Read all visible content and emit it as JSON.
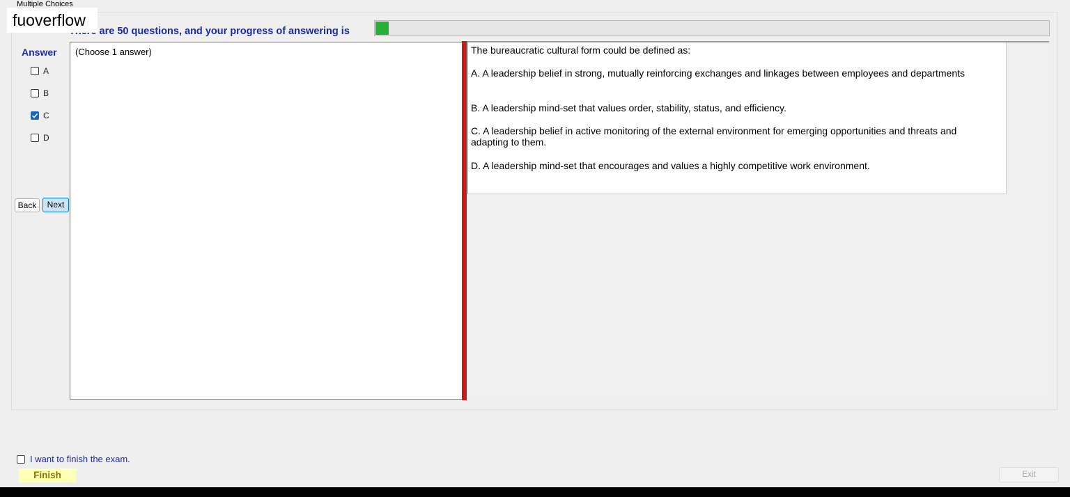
{
  "group_title": "Multiple Choices",
  "overlay_label": "fuoverflow",
  "progress": {
    "text": "There are 50 questions, and your progress of answering is",
    "fraction": 0.02,
    "fill_color": "#26b035"
  },
  "answer": {
    "heading": "Answer",
    "options": [
      {
        "label": "A",
        "checked": false
      },
      {
        "label": "B",
        "checked": false
      },
      {
        "label": "C",
        "checked": true
      },
      {
        "label": "D",
        "checked": false
      }
    ]
  },
  "nav": {
    "back_label": "Back",
    "next_label": "Next"
  },
  "left_pane": {
    "note": "(Choose 1 answer)"
  },
  "question": {
    "stem": "The bureaucratic cultural form could be defined as:",
    "choices": [
      "A.  A leadership belief in strong, mutually reinforcing exchanges and linkages between employees and departments",
      "B.  A leadership mind-set that values order, stability, status, and efficiency.",
      "C.  A leadership belief in active monitoring of the external environment for emerging opportunities and threats and adapting to them.",
      "D.  A leadership mind-set that encourages and values a highly competitive work environment."
    ]
  },
  "footer": {
    "finish_checkbox_label": "I want to finish the exam.",
    "finish_label": "Finish",
    "exit_label": "Exit"
  },
  "colors": {
    "accent_blue": "#1a2aa8",
    "splitter_red": "#c41b1b",
    "checked_blue": "#1565c0"
  }
}
